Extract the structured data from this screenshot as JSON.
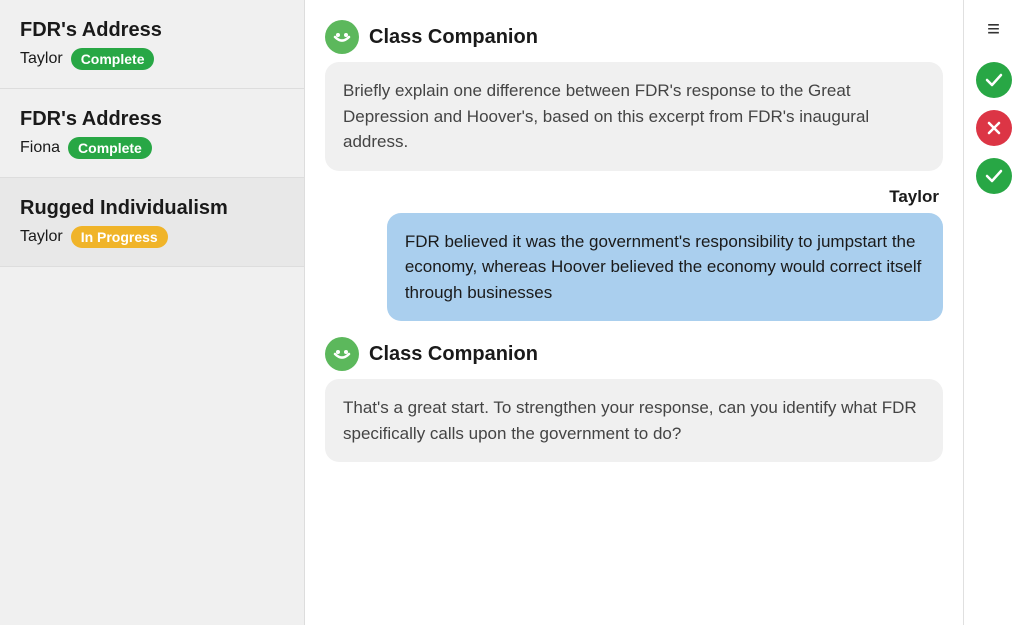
{
  "sidebar": {
    "items": [
      {
        "title": "FDR's Address",
        "user": "Taylor",
        "badge": "Complete",
        "badge_type": "complete",
        "active": false
      },
      {
        "title": "FDR's Address",
        "user": "Fiona",
        "badge": "Complete",
        "badge_type": "complete",
        "active": false
      },
      {
        "title": "Rugged Individualism",
        "user": "Taylor",
        "badge": "In Progress",
        "badge_type": "inprogress",
        "active": true
      }
    ]
  },
  "chat": {
    "companion_name": "Class Companion",
    "companion_avatar_icon": "😊",
    "messages": [
      {
        "type": "companion",
        "text": "Briefly explain one difference between FDR's response to the Great Depression and Hoover's, based on this excerpt from FDR's inaugural address."
      },
      {
        "type": "user",
        "user": "Taylor",
        "text": "FDR believed it was the government's responsibility to jumpstart the economy, whereas Hoover believed the economy would correct itself through businesses"
      },
      {
        "type": "companion",
        "text": "That's a great start. To strengthen your response, can you identify what FDR specifically calls upon the government to do?"
      }
    ]
  },
  "right_panel": {
    "menu_icon": "≡",
    "actions": [
      {
        "type": "check",
        "label": "approve"
      },
      {
        "type": "x",
        "label": "reject"
      },
      {
        "type": "check",
        "label": "approve"
      }
    ]
  }
}
